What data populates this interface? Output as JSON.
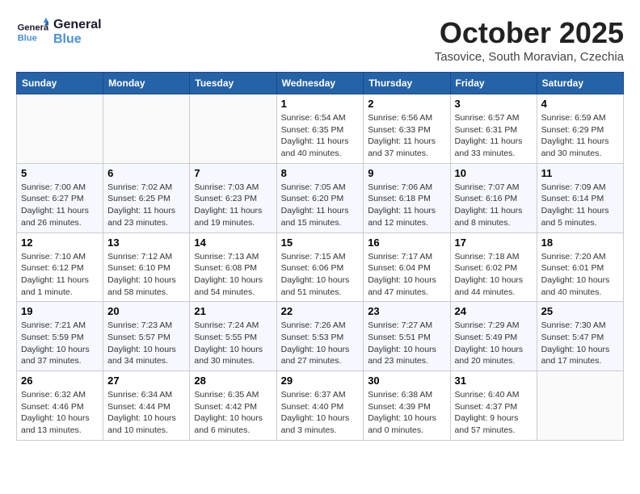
{
  "header": {
    "logo_line1": "General",
    "logo_line2": "Blue",
    "month": "October 2025",
    "location": "Tasovice, South Moravian, Czechia"
  },
  "days_of_week": [
    "Sunday",
    "Monday",
    "Tuesday",
    "Wednesday",
    "Thursday",
    "Friday",
    "Saturday"
  ],
  "weeks": [
    [
      {
        "day": "",
        "info": ""
      },
      {
        "day": "",
        "info": ""
      },
      {
        "day": "",
        "info": ""
      },
      {
        "day": "1",
        "info": "Sunrise: 6:54 AM\nSunset: 6:35 PM\nDaylight: 11 hours and 40 minutes."
      },
      {
        "day": "2",
        "info": "Sunrise: 6:56 AM\nSunset: 6:33 PM\nDaylight: 11 hours and 37 minutes."
      },
      {
        "day": "3",
        "info": "Sunrise: 6:57 AM\nSunset: 6:31 PM\nDaylight: 11 hours and 33 minutes."
      },
      {
        "day": "4",
        "info": "Sunrise: 6:59 AM\nSunset: 6:29 PM\nDaylight: 11 hours and 30 minutes."
      }
    ],
    [
      {
        "day": "5",
        "info": "Sunrise: 7:00 AM\nSunset: 6:27 PM\nDaylight: 11 hours and 26 minutes."
      },
      {
        "day": "6",
        "info": "Sunrise: 7:02 AM\nSunset: 6:25 PM\nDaylight: 11 hours and 23 minutes."
      },
      {
        "day": "7",
        "info": "Sunrise: 7:03 AM\nSunset: 6:23 PM\nDaylight: 11 hours and 19 minutes."
      },
      {
        "day": "8",
        "info": "Sunrise: 7:05 AM\nSunset: 6:20 PM\nDaylight: 11 hours and 15 minutes."
      },
      {
        "day": "9",
        "info": "Sunrise: 7:06 AM\nSunset: 6:18 PM\nDaylight: 11 hours and 12 minutes."
      },
      {
        "day": "10",
        "info": "Sunrise: 7:07 AM\nSunset: 6:16 PM\nDaylight: 11 hours and 8 minutes."
      },
      {
        "day": "11",
        "info": "Sunrise: 7:09 AM\nSunset: 6:14 PM\nDaylight: 11 hours and 5 minutes."
      }
    ],
    [
      {
        "day": "12",
        "info": "Sunrise: 7:10 AM\nSunset: 6:12 PM\nDaylight: 11 hours and 1 minute."
      },
      {
        "day": "13",
        "info": "Sunrise: 7:12 AM\nSunset: 6:10 PM\nDaylight: 10 hours and 58 minutes."
      },
      {
        "day": "14",
        "info": "Sunrise: 7:13 AM\nSunset: 6:08 PM\nDaylight: 10 hours and 54 minutes."
      },
      {
        "day": "15",
        "info": "Sunrise: 7:15 AM\nSunset: 6:06 PM\nDaylight: 10 hours and 51 minutes."
      },
      {
        "day": "16",
        "info": "Sunrise: 7:17 AM\nSunset: 6:04 PM\nDaylight: 10 hours and 47 minutes."
      },
      {
        "day": "17",
        "info": "Sunrise: 7:18 AM\nSunset: 6:02 PM\nDaylight: 10 hours and 44 minutes."
      },
      {
        "day": "18",
        "info": "Sunrise: 7:20 AM\nSunset: 6:01 PM\nDaylight: 10 hours and 40 minutes."
      }
    ],
    [
      {
        "day": "19",
        "info": "Sunrise: 7:21 AM\nSunset: 5:59 PM\nDaylight: 10 hours and 37 minutes."
      },
      {
        "day": "20",
        "info": "Sunrise: 7:23 AM\nSunset: 5:57 PM\nDaylight: 10 hours and 34 minutes."
      },
      {
        "day": "21",
        "info": "Sunrise: 7:24 AM\nSunset: 5:55 PM\nDaylight: 10 hours and 30 minutes."
      },
      {
        "day": "22",
        "info": "Sunrise: 7:26 AM\nSunset: 5:53 PM\nDaylight: 10 hours and 27 minutes."
      },
      {
        "day": "23",
        "info": "Sunrise: 7:27 AM\nSunset: 5:51 PM\nDaylight: 10 hours and 23 minutes."
      },
      {
        "day": "24",
        "info": "Sunrise: 7:29 AM\nSunset: 5:49 PM\nDaylight: 10 hours and 20 minutes."
      },
      {
        "day": "25",
        "info": "Sunrise: 7:30 AM\nSunset: 5:47 PM\nDaylight: 10 hours and 17 minutes."
      }
    ],
    [
      {
        "day": "26",
        "info": "Sunrise: 6:32 AM\nSunset: 4:46 PM\nDaylight: 10 hours and 13 minutes."
      },
      {
        "day": "27",
        "info": "Sunrise: 6:34 AM\nSunset: 4:44 PM\nDaylight: 10 hours and 10 minutes."
      },
      {
        "day": "28",
        "info": "Sunrise: 6:35 AM\nSunset: 4:42 PM\nDaylight: 10 hours and 6 minutes."
      },
      {
        "day": "29",
        "info": "Sunrise: 6:37 AM\nSunset: 4:40 PM\nDaylight: 10 hours and 3 minutes."
      },
      {
        "day": "30",
        "info": "Sunrise: 6:38 AM\nSunset: 4:39 PM\nDaylight: 10 hours and 0 minutes."
      },
      {
        "day": "31",
        "info": "Sunrise: 6:40 AM\nSunset: 4:37 PM\nDaylight: 9 hours and 57 minutes."
      },
      {
        "day": "",
        "info": ""
      }
    ]
  ]
}
